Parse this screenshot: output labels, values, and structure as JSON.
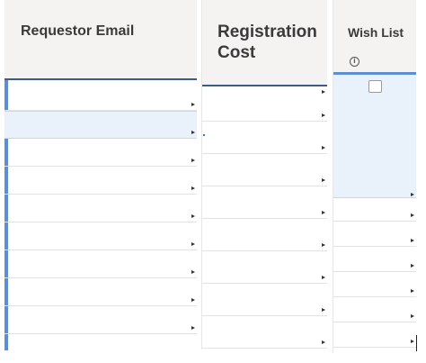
{
  "columns": {
    "requestor_email": {
      "label": "Requestor Email"
    },
    "registration_cost": {
      "label": "Registration\nCost"
    },
    "wish_list": {
      "label": "Wish List",
      "info_icon": "info-icon",
      "select_all_checked": false
    }
  },
  "colors": {
    "header_bg": "#f4f3f1",
    "header_underline": "#3d5a8a",
    "selected_row_bg": "#e9f1fb",
    "accent_bar": "#5b8fd0"
  }
}
